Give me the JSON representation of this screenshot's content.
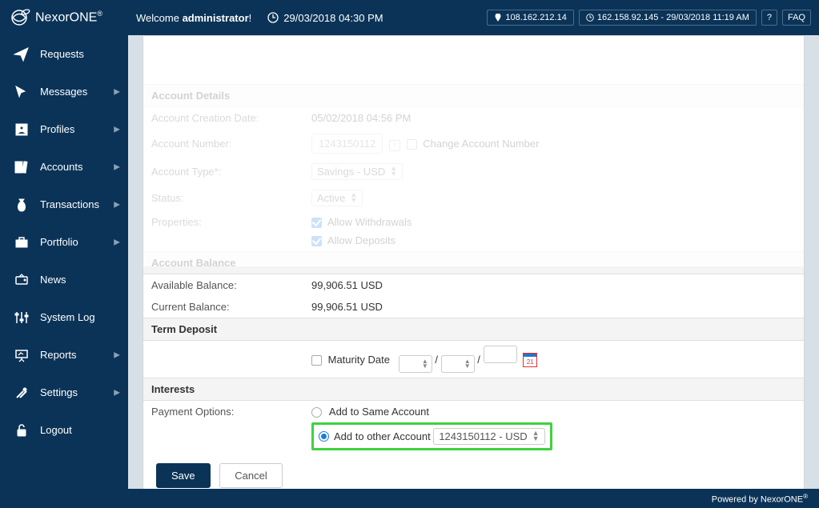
{
  "header": {
    "brand": "NexorONE",
    "brand_reg": "®",
    "welcome_prefix": "Welcome ",
    "welcome_user": "administrator",
    "welcome_suffix": "!",
    "datetime": "29/03/2018 04:30 PM",
    "ip_current": "108.162.212.14",
    "ip_last": "162.158.92.145 - 29/03/2018 11:19 AM",
    "help_label": "?",
    "faq_label": "FAQ"
  },
  "sidebar": {
    "items": [
      {
        "label": "Requests",
        "icon": "paper-plane",
        "arrow": false
      },
      {
        "label": "Messages",
        "icon": "cursor",
        "arrow": true
      },
      {
        "label": "Profiles",
        "icon": "profile",
        "arrow": true
      },
      {
        "label": "Accounts",
        "icon": "books",
        "arrow": true
      },
      {
        "label": "Transactions",
        "icon": "money-bag",
        "arrow": true
      },
      {
        "label": "Portfolio",
        "icon": "briefcase",
        "arrow": true
      },
      {
        "label": "News",
        "icon": "tv",
        "arrow": false
      },
      {
        "label": "System Log",
        "icon": "sliders",
        "arrow": false
      },
      {
        "label": "Reports",
        "icon": "presentation",
        "arrow": true
      },
      {
        "label": "Settings",
        "icon": "tools",
        "arrow": true
      },
      {
        "label": "Logout",
        "icon": "lock",
        "arrow": false
      }
    ]
  },
  "form": {
    "sections": {
      "account_details_header": "Account Details",
      "account_balance_header": "Account Balance",
      "term_deposit_header": "Term Deposit",
      "interests_header": "Interests"
    },
    "account_creation_date_label": "Account Creation Date:",
    "account_creation_date_value": "05/02/2018 04:56 PM",
    "account_number_label": "Account Number:",
    "account_number_value": "1243150112",
    "change_account_number_label": "Change Account Number",
    "account_type_label": "Account Type*:",
    "account_type_value": "Savings - USD",
    "status_label": "Status:",
    "status_value": "Active",
    "properties_label": "Properties:",
    "allow_withdrawals_label": "Allow Withdrawals",
    "allow_deposits_label": "Allow Deposits",
    "available_balance_label": "Available Balance:",
    "available_balance_value": "99,906.51 USD",
    "current_balance_label": "Current Balance:",
    "current_balance_value": "99,906.51 USD",
    "maturity_date_label": "Maturity Date",
    "maturity_slash": "/",
    "calendar_day": "21",
    "payment_options_label": "Payment Options:",
    "add_to_same_label": "Add to Same Account",
    "add_to_other_label": "Add to other Account",
    "other_account_selected": "1243150112 - USD"
  },
  "actions": {
    "save": "Save",
    "cancel": "Cancel"
  },
  "footer": {
    "powered_by": "Powered by NexorONE",
    "reg": "®"
  }
}
